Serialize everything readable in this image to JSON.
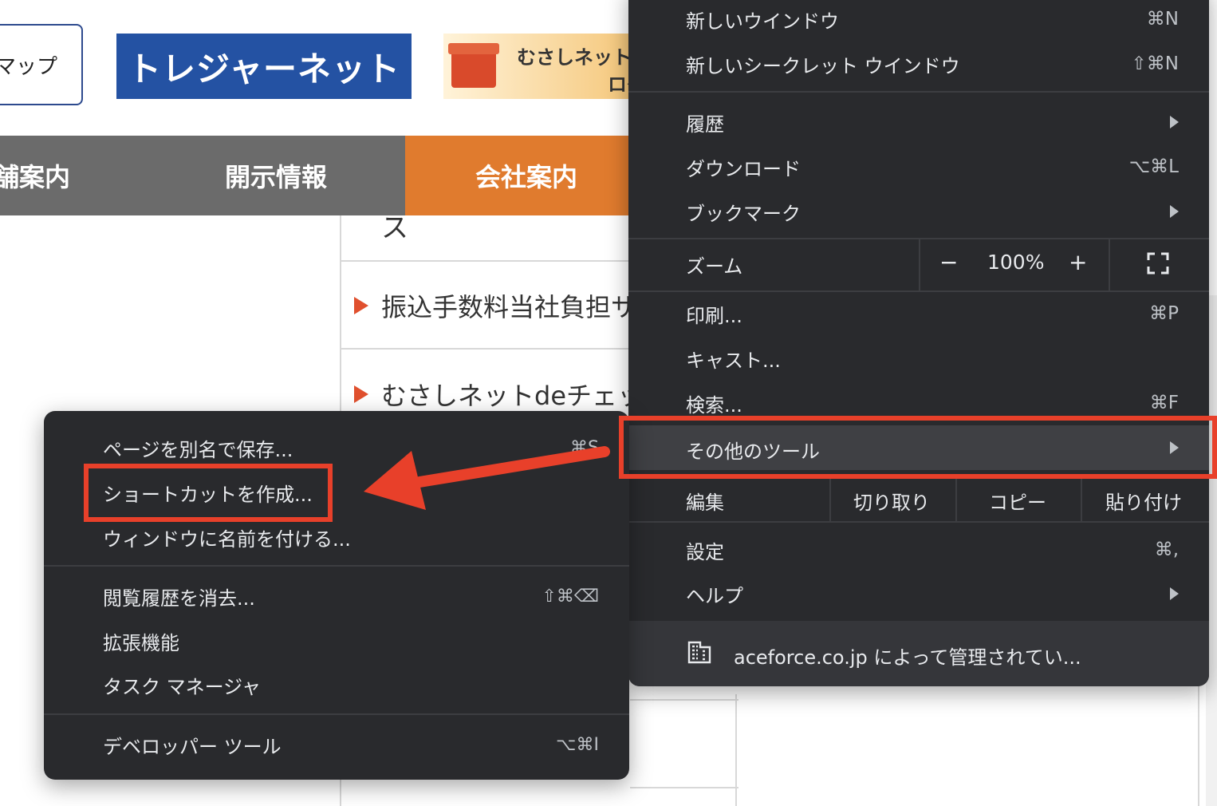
{
  "page": {
    "sitemap_label": "マップ",
    "treasure_logo": "トレジャーネット",
    "musashi_line1": "むさしネット",
    "musashi_line2": "ログ",
    "nav": {
      "store": "舗案内",
      "disclosure": "開示情報",
      "company": "会社案内"
    },
    "top_item_fragment": "ス",
    "news": [
      {
        "text": "振込手数料当社負担サ"
      },
      {
        "text": "むさしネットdeチェッ"
      }
    ]
  },
  "main_menu": {
    "new_window": {
      "label": "新しいウインドウ",
      "shortcut": "⌘N"
    },
    "new_incognito": {
      "label": "新しいシークレット ウインドウ",
      "shortcut": "⇧⌘N"
    },
    "history": {
      "label": "履歴"
    },
    "downloads": {
      "label": "ダウンロード",
      "shortcut": "⌥⌘L"
    },
    "bookmarks": {
      "label": "ブックマーク"
    },
    "zoom": {
      "label": "ズーム",
      "minus": "−",
      "percent": "100%",
      "plus": "+"
    },
    "print": {
      "label": "印刷...",
      "shortcut": "⌘P"
    },
    "cast": {
      "label": "キャスト..."
    },
    "find": {
      "label": "検索...",
      "shortcut": "⌘F"
    },
    "more_tools": {
      "label": "その他のツール"
    },
    "edit": {
      "label": "編集",
      "cut": "切り取り",
      "copy": "コピー",
      "paste": "貼り付け"
    },
    "settings": {
      "label": "設定",
      "shortcut": "⌘,"
    },
    "help": {
      "label": "ヘルプ"
    },
    "managed_by": "aceforce.co.jp によって管理されてい..."
  },
  "sub_menu": {
    "save_page": {
      "label": "ページを別名で保存...",
      "shortcut": "⌘S"
    },
    "create_shortcut": {
      "label": "ショートカットを作成..."
    },
    "name_window": {
      "label": "ウィンドウに名前を付ける..."
    },
    "clear_history": {
      "label": "閲覧履歴を消去...",
      "shortcut": "⇧⌘⌫"
    },
    "extensions": {
      "label": "拡張機能"
    },
    "task_manager": {
      "label": "タスク マネージャ"
    },
    "dev_tools": {
      "label": "デベロッパー ツール",
      "shortcut": "⌥⌘I"
    }
  },
  "colors": {
    "menu_bg": "#292a2d",
    "annotation_red": "#e8402a",
    "nav_gray": "#6b6b6b",
    "nav_orange": "#e07b2e",
    "logo_blue": "#2452a3"
  }
}
